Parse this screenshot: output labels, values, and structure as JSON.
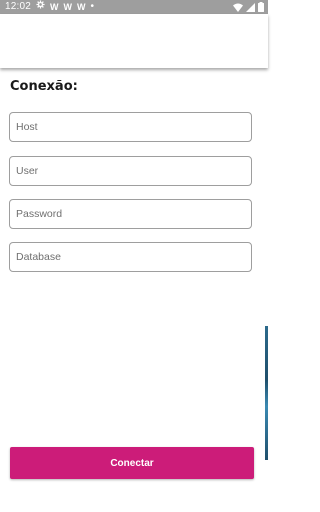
{
  "status_bar": {
    "time": "12:02",
    "notification_icons": [
      "gear-icon",
      "w-notification-icon",
      "w-notification-icon",
      "w-notification-icon",
      "dot-icon"
    ],
    "notif_letter": "W",
    "dot": "•",
    "right_icons": [
      "wifi-icon",
      "signal-icon",
      "battery-icon"
    ]
  },
  "connection": {
    "title": "Conexão:",
    "host_placeholder": "Host",
    "user_placeholder": "User",
    "password_placeholder": "Password",
    "database_placeholder": "Database",
    "connect_label": "Conectar"
  },
  "colors": {
    "accent": "#cc1c79",
    "status_bar": "#9e9e9e"
  }
}
